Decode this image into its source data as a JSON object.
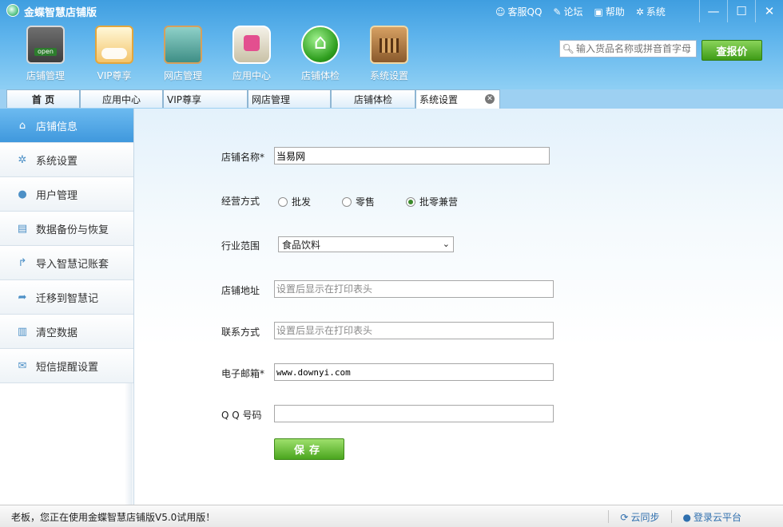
{
  "app": {
    "title": "金蝶智慧店铺版"
  },
  "top_links": [
    {
      "icon": "qq-icon",
      "label": "客服QQ"
    },
    {
      "icon": "forum-icon",
      "label": "论坛"
    },
    {
      "icon": "help-icon",
      "label": "帮助"
    },
    {
      "icon": "gear-icon",
      "label": "系统"
    }
  ],
  "window_controls": {
    "minimize": "—",
    "maximize": "☐",
    "close": "✕"
  },
  "toolbar": [
    {
      "label": "店铺管理",
      "icon": "shop-open-icon"
    },
    {
      "label": "VIP尊享",
      "icon": "vip-card-icon"
    },
    {
      "label": "网店管理",
      "icon": "online-store-icon"
    },
    {
      "label": "应用中心",
      "icon": "app-center-icon"
    },
    {
      "label": "店铺体检",
      "icon": "health-check-icon"
    },
    {
      "label": "系统设置",
      "icon": "settings-box-icon"
    }
  ],
  "search": {
    "placeholder": "输入货品名称或拼音首字母",
    "button": "查报价"
  },
  "tabs": [
    {
      "label": "首 页"
    },
    {
      "label": "应用中心"
    },
    {
      "label": "VIP尊享"
    },
    {
      "label": "网店管理"
    },
    {
      "label": "店铺体检"
    },
    {
      "label": "系统设置",
      "active": true
    }
  ],
  "sidebar": [
    {
      "label": "店铺信息",
      "icon": "store-icon",
      "active": true
    },
    {
      "label": "系统设置",
      "icon": "gear-icon"
    },
    {
      "label": "用户管理",
      "icon": "user-icon"
    },
    {
      "label": "数据备份与恢复",
      "icon": "backup-icon"
    },
    {
      "label": "导入智慧记账套",
      "icon": "import-icon"
    },
    {
      "label": "迁移到智慧记",
      "icon": "migrate-icon"
    },
    {
      "label": "清空数据",
      "icon": "trash-icon"
    },
    {
      "label": "短信提醒设置",
      "icon": "sms-icon"
    }
  ],
  "form": {
    "store_name": {
      "label": "店铺名称*",
      "value": "当易网"
    },
    "business_mode": {
      "label": "经营方式",
      "options": [
        "批发",
        "零售",
        "批零兼营"
      ],
      "selected": "批零兼营"
    },
    "industry": {
      "label": "行业范围",
      "value": "食品饮料"
    },
    "address": {
      "label": "店铺地址",
      "placeholder": "设置后显示在打印表头"
    },
    "contact": {
      "label": "联系方式",
      "placeholder": "设置后显示在打印表头"
    },
    "email": {
      "label": "电子邮箱*",
      "value": "www.downyi.com"
    },
    "qq": {
      "label": "Q Q 号码",
      "value": ""
    },
    "save": "保存"
  },
  "status": {
    "text": "老板，您正在使用金蝶智慧店铺版V5.0试用版！",
    "cloud_sync": "云同步",
    "cloud_login": "登录云平台"
  }
}
